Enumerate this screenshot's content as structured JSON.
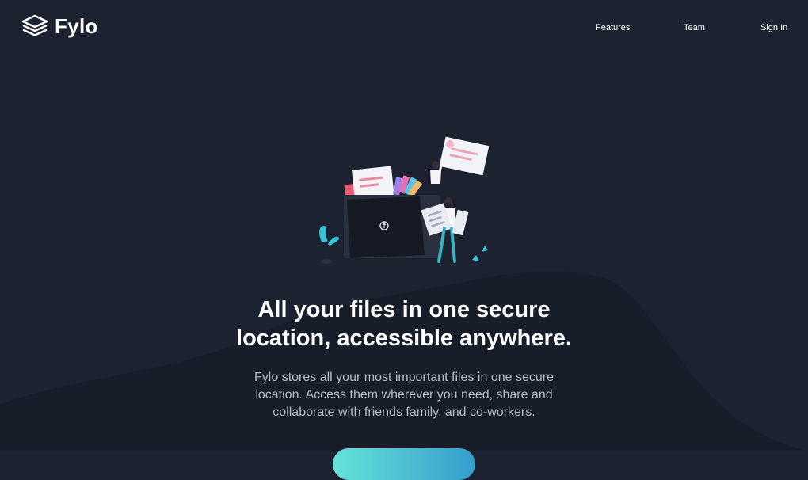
{
  "header": {
    "logo_text": "Fylo",
    "nav": [
      {
        "label": "Features"
      },
      {
        "label": "Team"
      },
      {
        "label": "Sign In"
      }
    ]
  },
  "hero": {
    "title_line1": "All your files in one secure",
    "title_line2": "location, accessible anywhere.",
    "subtitle_line1": "Fylo stores all your most important files in one secure",
    "subtitle_line2": "location. Access them wherever you need, share and",
    "subtitle_line3": "collaborate with friends family, and co-workers.",
    "cta_label": ""
  },
  "colors": {
    "background": "#1c2230",
    "curve": "#181e29",
    "accent_start": "#65e2d9",
    "accent_end": "#339ecc",
    "subtitle_text": "#b7bcc8"
  },
  "icons": {
    "logo": "stacked-layers-icon"
  }
}
